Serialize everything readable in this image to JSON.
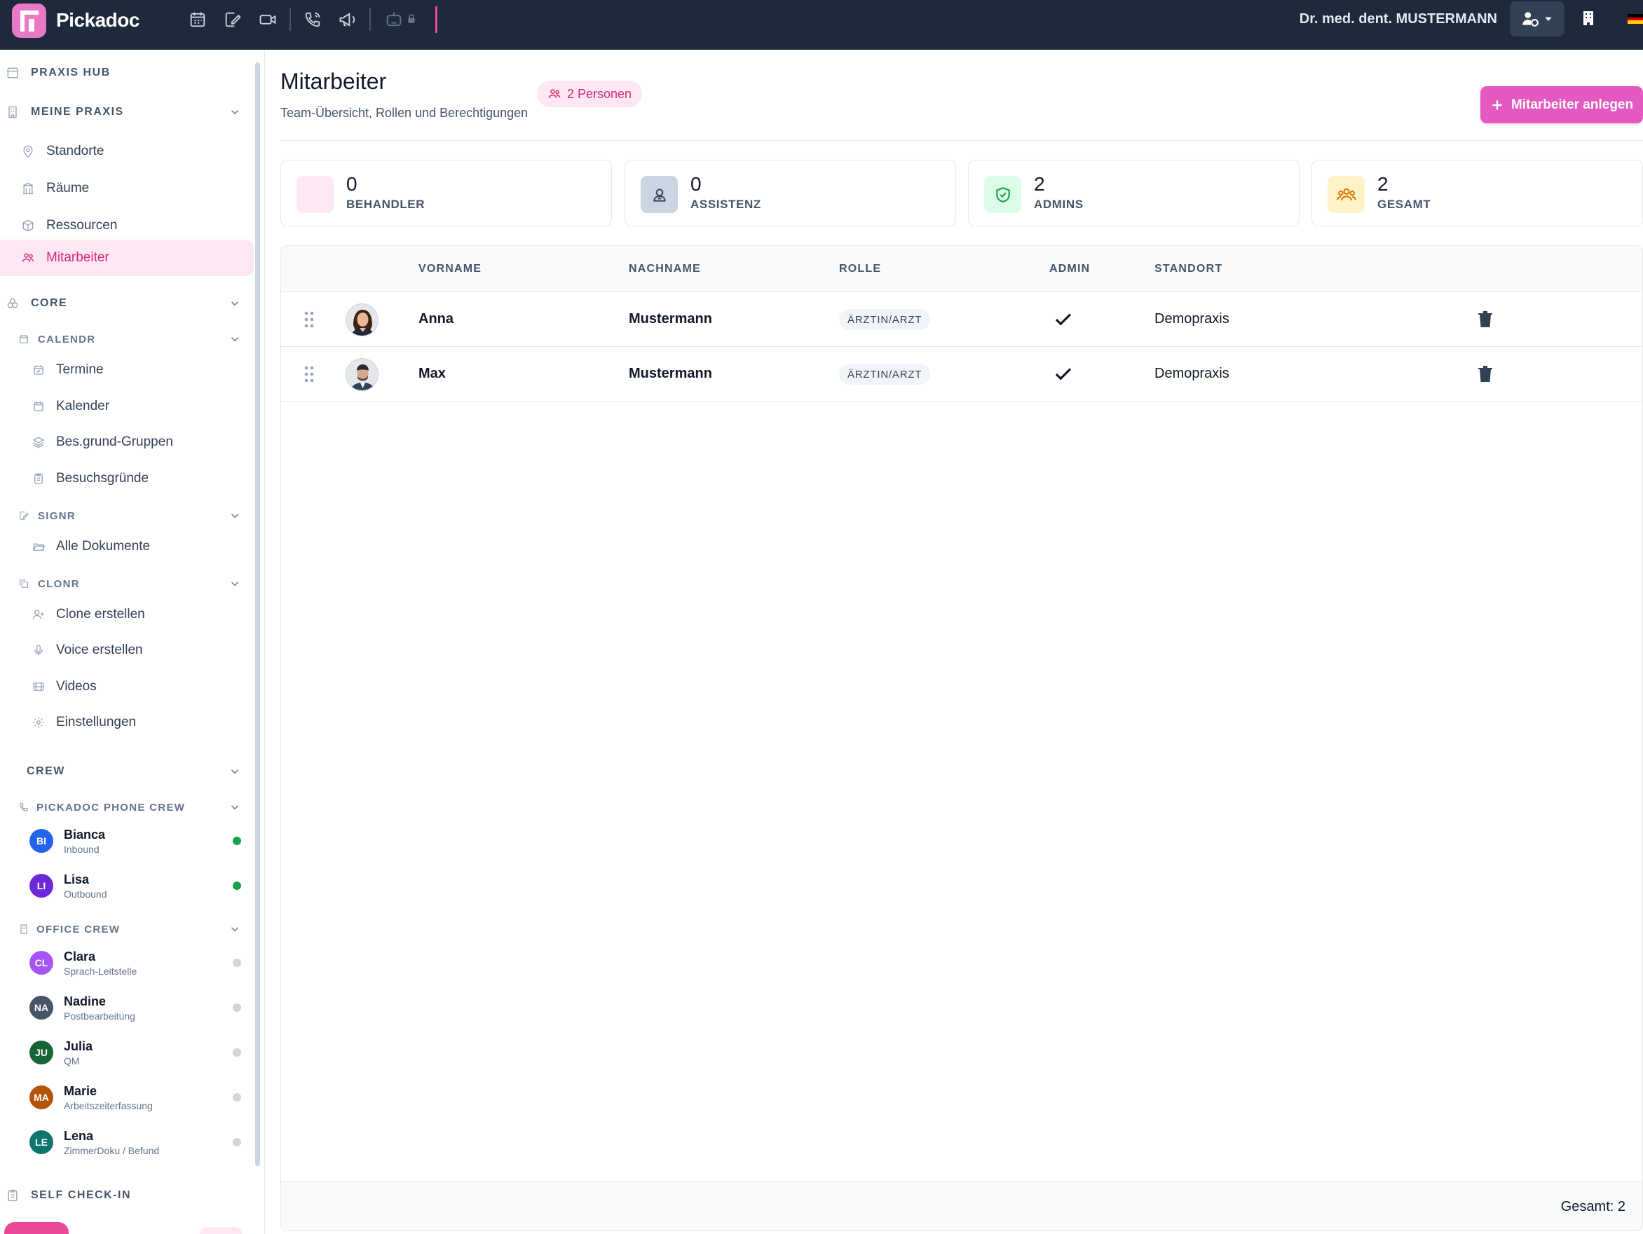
{
  "app": {
    "brand": "Pickadoc",
    "user_name": "Dr. med. dent. MUSTERMANN"
  },
  "sidebar": {
    "praxis_hub": "PRAXIS HUB",
    "meine_praxis": "MEINE PRAXIS",
    "meine_praxis_items": [
      "Standorte",
      "Räume",
      "Ressourcen",
      "Mitarbeiter"
    ],
    "core": "CORE",
    "calendr": "CALENDR",
    "calendr_items": [
      "Termine",
      "Kalender",
      "Bes.grund-Gruppen",
      "Besuchsgründe"
    ],
    "signr": "SIGNR",
    "signr_items": [
      "Alle Dokumente"
    ],
    "clonr": "CLONR",
    "clonr_items": [
      "Clone erstellen",
      "Voice erstellen",
      "Videos",
      "Einstellungen"
    ],
    "crew": "CREW",
    "phone_crew": "PICKADOC PHONE CREW",
    "phone_crew_members": [
      {
        "initials": "BI",
        "name": "Bianca",
        "role": "Inbound",
        "color": "#2563eb",
        "status": "#16a34a"
      },
      {
        "initials": "LI",
        "name": "Lisa",
        "role": "Outbound",
        "color": "#6d28d9",
        "status": "#16a34a"
      }
    ],
    "office_crew": "OFFICE CREW",
    "office_crew_members": [
      {
        "initials": "CL",
        "name": "Clara",
        "role": "Sprach-Leitstelle",
        "color": "#a855f7",
        "status": "#d1d5db"
      },
      {
        "initials": "NA",
        "name": "Nadine",
        "role": "Postbearbeitung",
        "color": "#475569",
        "status": "#d1d5db"
      },
      {
        "initials": "JU",
        "name": "Julia",
        "role": "QM",
        "color": "#166534",
        "status": "#d1d5db"
      },
      {
        "initials": "MA",
        "name": "Marie",
        "role": "Arbeitszeiterfassung",
        "color": "#b45309",
        "status": "#d1d5db"
      },
      {
        "initials": "LE",
        "name": "Lena",
        "role": "ZimmerDoku / Befund",
        "color": "#0f766e",
        "status": "#d1d5db"
      }
    ],
    "self_checkin": "SELF CHECK-IN"
  },
  "page": {
    "title": "Mitarbeiter",
    "subtitle": "Team-Übersicht, Rollen und Berechtigungen",
    "persons_badge": "2 Personen",
    "add_button": "Mitarbeiter anlegen"
  },
  "stats": [
    {
      "value": "0",
      "label": "BEHANDLER",
      "bg": "#fce7f3",
      "fg": "#db2777",
      "icon": "empty-icon"
    },
    {
      "value": "0",
      "label": "ASSISTENZ",
      "bg": "#cbd5e1",
      "fg": "#334155",
      "icon": "user-badge-icon"
    },
    {
      "value": "2",
      "label": "ADMINS",
      "bg": "#dcfce7",
      "fg": "#16a34a",
      "icon": "shield-check-icon"
    },
    {
      "value": "2",
      "label": "GESAMT",
      "bg": "#fef3c7",
      "fg": "#d97706",
      "icon": "users-icon"
    }
  ],
  "table": {
    "columns": [
      "VORNAME",
      "NACHNAME",
      "ROLLE",
      "ADMIN",
      "STANDORT"
    ],
    "rows": [
      {
        "first": "Anna",
        "last": "Mustermann",
        "role": "ÄRZTIN/ARZT",
        "admin": true,
        "location": "Demopraxis"
      },
      {
        "first": "Max",
        "last": "Mustermann",
        "role": "ÄRZTIN/ARZT",
        "admin": true,
        "location": "Demopraxis"
      }
    ],
    "footer_total": "Gesamt: 2"
  }
}
